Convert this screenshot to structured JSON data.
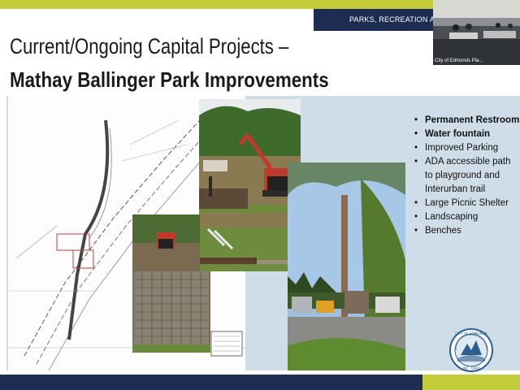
{
  "header": {
    "org": "PARKS, RECREATION AND H"
  },
  "slide": {
    "title_line1": "Current/Ongoing Capital Projects –",
    "title_line2": "Mathay Ballinger Park Improvements",
    "bullets": [
      {
        "text": "Permanent Restroom",
        "bold": true
      },
      {
        "text": "Water fountain",
        "bold": true
      },
      {
        "text": "Improved Parking",
        "bold": false
      },
      {
        "text": "ADA accessible path to playground and Interurban trail",
        "bold": false
      },
      {
        "text": "Large Picnic Shelter",
        "bold": false
      },
      {
        "text": "Landscaping",
        "bold": false
      },
      {
        "text": "Benches",
        "bold": false
      }
    ]
  },
  "video": {
    "participant_label": "City of Edmonds Pla..."
  },
  "seal": {
    "text_top": "CITY OF EDMONDS",
    "text_bottom": "INC. 1890"
  },
  "colors": {
    "accent_lime": "#c3cd3c",
    "navy": "#1d2d52",
    "panel": "#cfdde8"
  }
}
